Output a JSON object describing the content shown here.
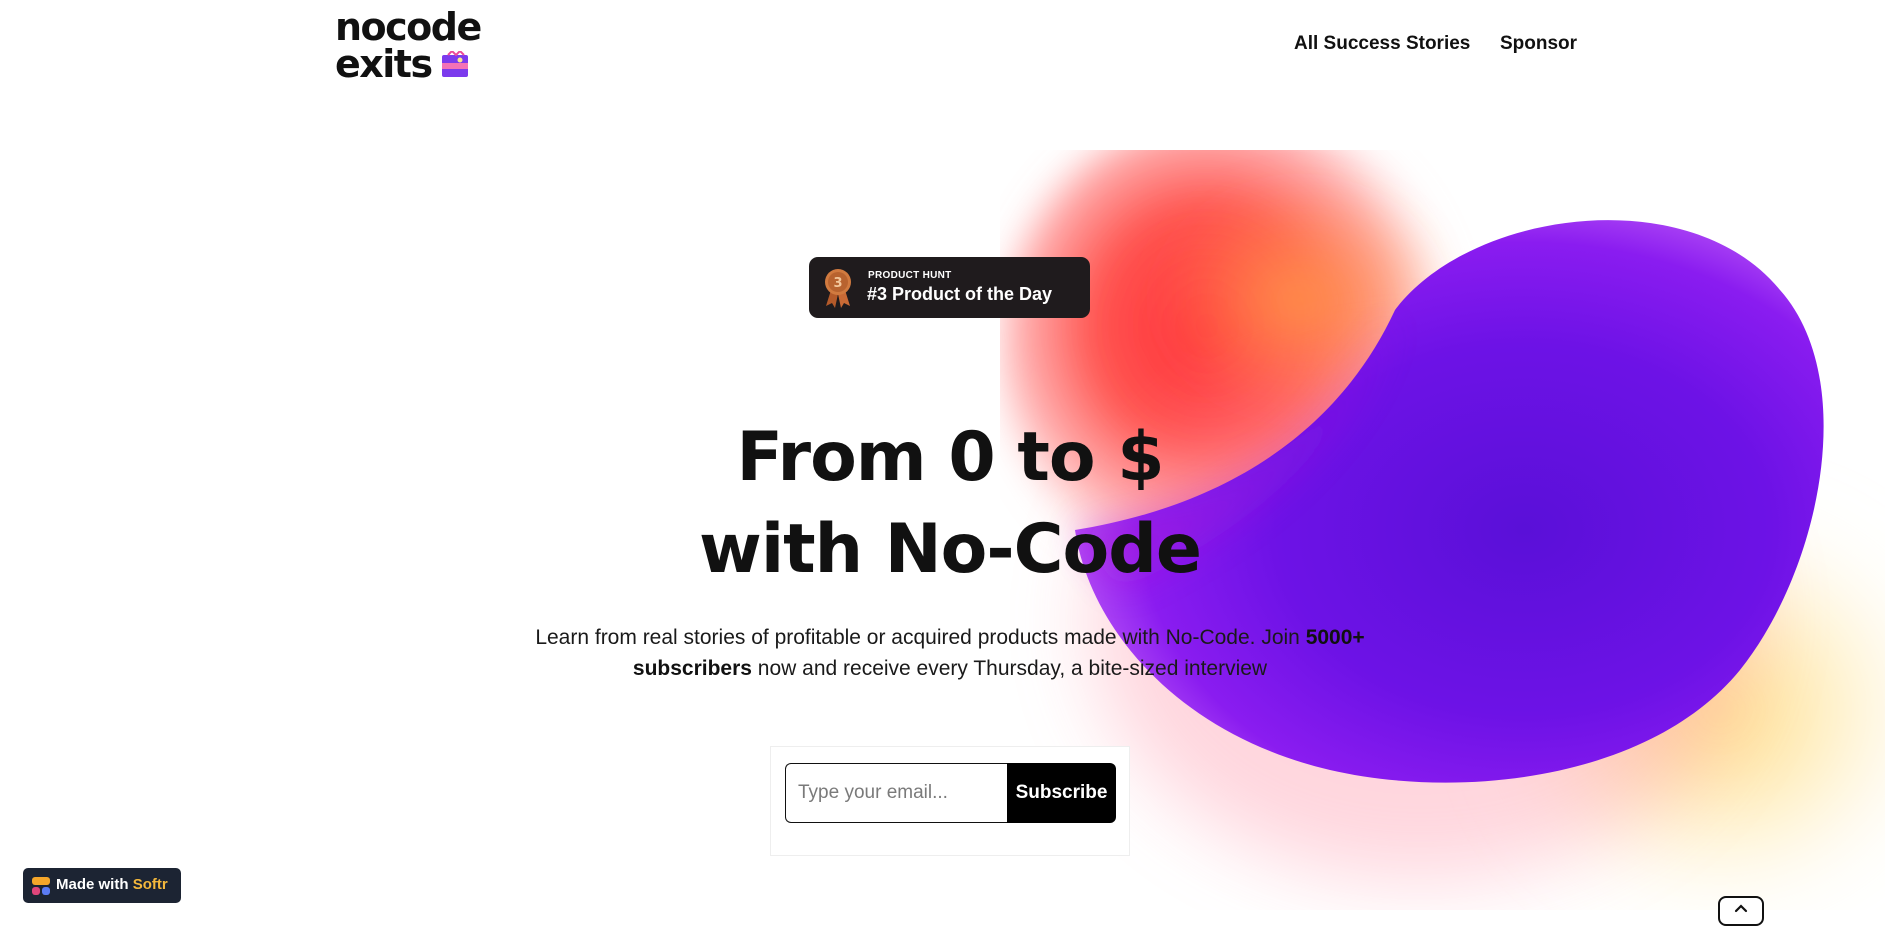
{
  "header": {
    "logo_line1": "nocode",
    "logo_line2": "exits",
    "nav": [
      {
        "label": "All Success Stories"
      },
      {
        "label": "Sponsor"
      }
    ]
  },
  "badge": {
    "icon": "bronze-medal-icon",
    "medal_number": "3",
    "kicker": "PRODUCT HUNT",
    "title": "#3 Product of the Day"
  },
  "hero": {
    "headline_line1": "From 0 to $",
    "headline_line2": "with No-Code",
    "subtitle_before": "Learn from real stories of profitable or acquired products made with No-Code. Join ",
    "subtitle_bold": "5000+ subscribers",
    "subtitle_after": " now and receive every Thursday, a bite-sized interview"
  },
  "form": {
    "email_placeholder": "Type your email...",
    "email_value": "",
    "subscribe_label": "Subscribe"
  },
  "softr": {
    "prefix": "Made with",
    "brand": "Softr"
  },
  "colors": {
    "accent_purple": "#6a0fe0",
    "accent_red": "#ff3b4a",
    "accent_yellow": "#ffd86b",
    "softr_brand": "#f4b83c",
    "badge_bg": "#1f1b1d"
  },
  "icons": {
    "logo_flag": "flag-icon",
    "scroll_top": "chevron-up-icon"
  }
}
